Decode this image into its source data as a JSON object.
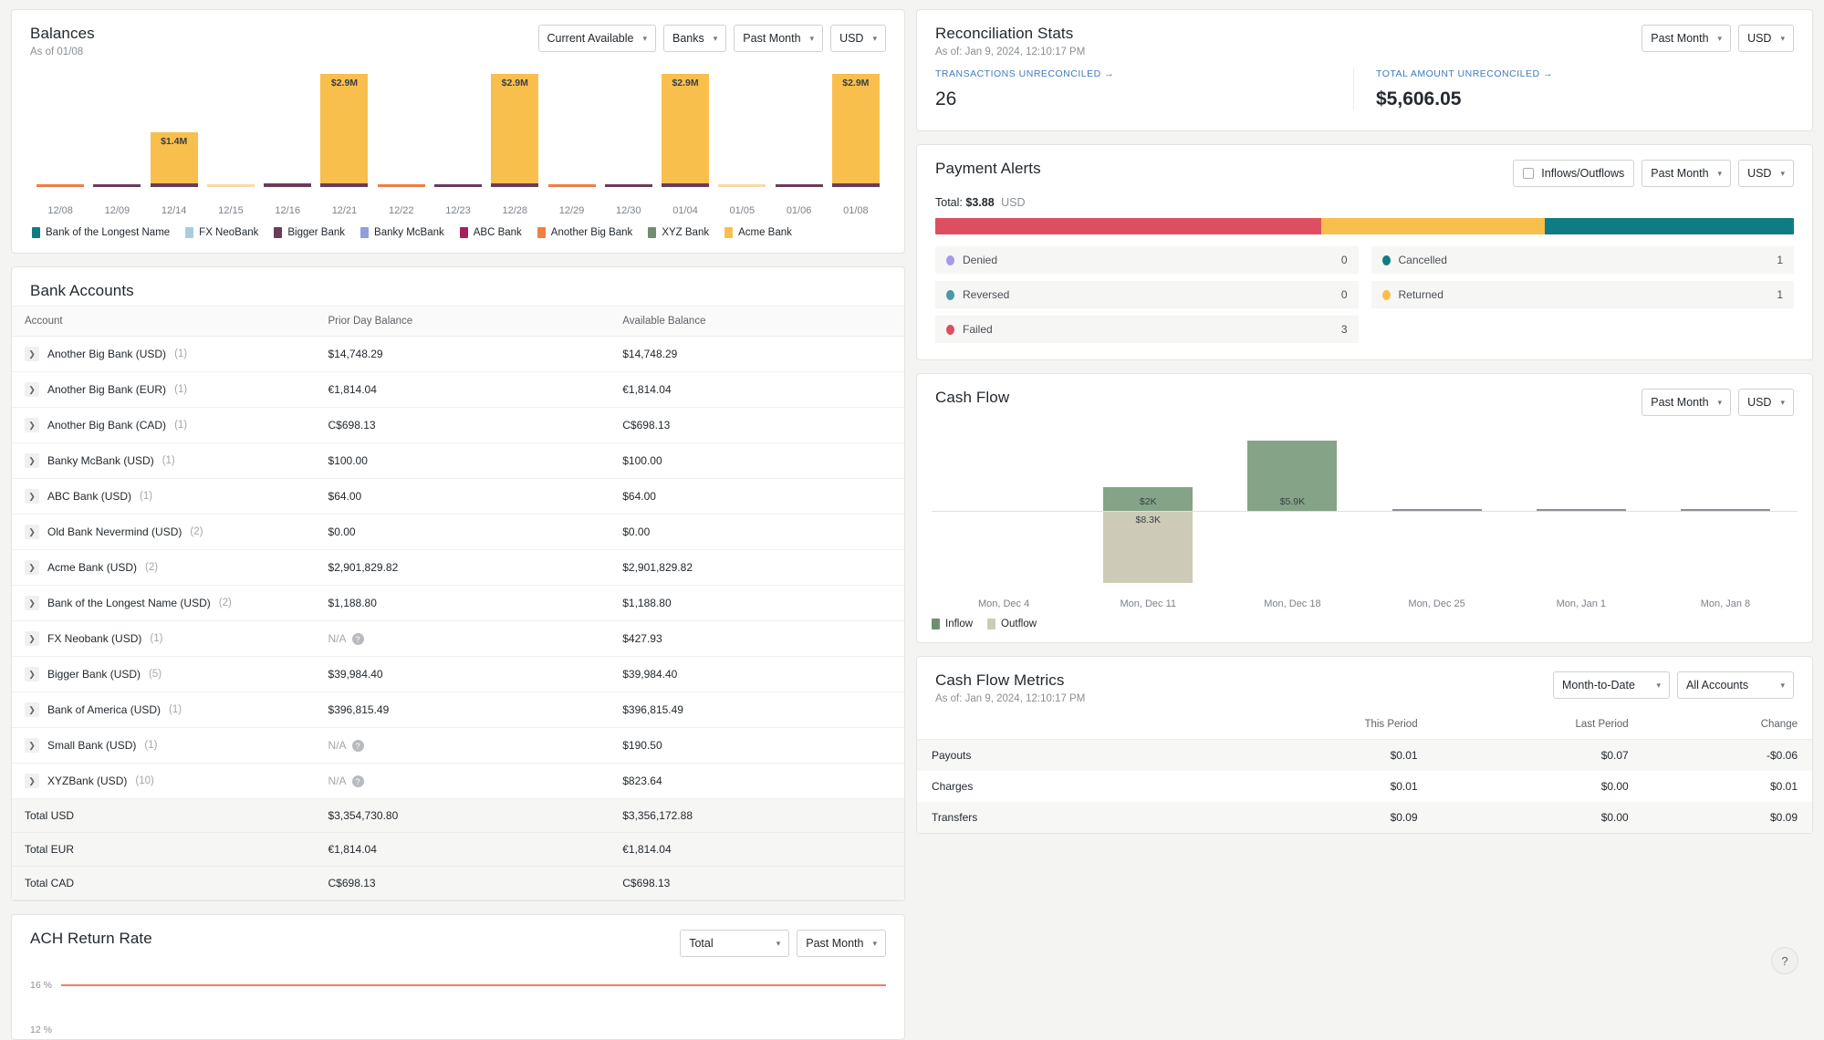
{
  "balances": {
    "title": "Balances",
    "subtitle": "As of 01/08",
    "controls": [
      {
        "name": "balance-type-select",
        "label": "Current Available"
      },
      {
        "name": "grouping-select",
        "label": "Banks"
      },
      {
        "name": "period-select",
        "label": "Past Month"
      },
      {
        "name": "currency-select",
        "label": "USD"
      }
    ],
    "chart_data": {
      "type": "bar",
      "title": "Balances",
      "xlabel": "",
      "ylabel": "",
      "categories": [
        "12/08",
        "12/09",
        "12/14",
        "12/15",
        "12/16",
        "12/21",
        "12/22",
        "12/23",
        "12/28",
        "12/29",
        "12/30",
        "01/04",
        "01/05",
        "01/06",
        "01/08"
      ],
      "values": [
        0.02,
        0.06,
        1.4,
        0.015,
        0.09,
        2.9,
        0.02,
        0.07,
        2.9,
        0.02,
        0.05,
        2.9,
        0.015,
        0.07,
        2.9
      ],
      "labels": [
        "",
        "",
        "$1.4M",
        "",
        "",
        "$2.9M",
        "",
        "",
        "$2.9M",
        "",
        "",
        "$2.9M",
        "",
        "",
        "$2.9M"
      ],
      "unit": "M USD",
      "legend_position": "bottom",
      "series": [
        {
          "name": "Acme Bank",
          "color": "#f9bf4d"
        },
        {
          "name": "Bigger Bank",
          "color": "#6b3b5a"
        },
        {
          "name": "Another Big Bank",
          "color": "#ef7e44"
        },
        {
          "name": "ABC Bank",
          "color": "#a81d5d"
        }
      ]
    },
    "legend": [
      {
        "label": "Bank of the Longest Name",
        "color": "#0f7c84"
      },
      {
        "label": "FX NeoBank",
        "color": "#a8cde0"
      },
      {
        "label": "Bigger Bank",
        "color": "#6b3b5a"
      },
      {
        "label": "Banky McBank",
        "color": "#8f9fe0"
      },
      {
        "label": "ABC Bank",
        "color": "#a81d5d"
      },
      {
        "label": "Another Big Bank",
        "color": "#ef7e44"
      },
      {
        "label": "XYZ Bank",
        "color": "#6f8f6e"
      },
      {
        "label": "Acme Bank",
        "color": "#f9bf4d"
      }
    ]
  },
  "bank_accounts": {
    "title": "Bank Accounts",
    "columns": [
      "Account",
      "Prior Day Balance",
      "Available Balance"
    ],
    "rows": [
      {
        "account": "Another Big Bank (USD)",
        "count": "(1)",
        "prior": "$14,748.29",
        "available": "$14,748.29",
        "prior_na": false
      },
      {
        "account": "Another Big Bank (EUR)",
        "count": "(1)",
        "prior": "€1,814.04",
        "available": "€1,814.04",
        "prior_na": false
      },
      {
        "account": "Another Big Bank (CAD)",
        "count": "(1)",
        "prior": "C$698.13",
        "available": "C$698.13",
        "prior_na": false
      },
      {
        "account": "Banky McBank (USD)",
        "count": "(1)",
        "prior": "$100.00",
        "available": "$100.00",
        "prior_na": false
      },
      {
        "account": "ABC Bank (USD)",
        "count": "(1)",
        "prior": "$64.00",
        "available": "$64.00",
        "prior_na": false
      },
      {
        "account": "Old Bank Nevermind (USD)",
        "count": "(2)",
        "prior": "$0.00",
        "available": "$0.00",
        "prior_na": false
      },
      {
        "account": "Acme Bank (USD)",
        "count": "(2)",
        "prior": "$2,901,829.82",
        "available": "$2,901,829.82",
        "prior_na": false
      },
      {
        "account": "Bank of the Longest Name (USD)",
        "count": "(2)",
        "prior": "$1,188.80",
        "available": "$1,188.80",
        "prior_na": false
      },
      {
        "account": "FX Neobank (USD)",
        "count": "(1)",
        "prior": "N/A",
        "available": "$427.93",
        "prior_na": true
      },
      {
        "account": "Bigger Bank (USD)",
        "count": "(5)",
        "prior": "$39,984.40",
        "available": "$39,984.40",
        "prior_na": false
      },
      {
        "account": "Bank of America (USD)",
        "count": "(1)",
        "prior": "$396,815.49",
        "available": "$396,815.49",
        "prior_na": false
      },
      {
        "account": "Small Bank (USD)",
        "count": "(1)",
        "prior": "N/A",
        "available": "$190.50",
        "prior_na": true
      },
      {
        "account": "XYZBank (USD)",
        "count": "(10)",
        "prior": "N/A",
        "available": "$823.64",
        "prior_na": true
      }
    ],
    "totals": [
      {
        "label": "Total USD",
        "prior": "$3,354,730.80",
        "available": "$3,356,172.88"
      },
      {
        "label": "Total EUR",
        "prior": "€1,814.04",
        "available": "€1,814.04"
      },
      {
        "label": "Total CAD",
        "prior": "C$698.13",
        "available": "C$698.13"
      }
    ]
  },
  "ach": {
    "title": "ACH Return Rate",
    "controls": [
      {
        "name": "ach-type-select",
        "label": "Total"
      },
      {
        "name": "ach-period-select",
        "label": "Past Month"
      }
    ],
    "chart_data": {
      "type": "line",
      "title": "ACH Return Rate",
      "ylabel": "%",
      "yticks": [
        "16 %",
        "12 %"
      ],
      "values": [
        16,
        16
      ],
      "line_color": "#ef7e63"
    }
  },
  "reconciliation": {
    "title": "Reconciliation Stats",
    "subtitle": "As of: Jan 9, 2024, 12:10:17 PM",
    "controls": [
      {
        "name": "recon-period-select",
        "label": "Past Month"
      },
      {
        "name": "recon-currency-select",
        "label": "USD"
      }
    ],
    "stats": [
      {
        "label": "TRANSACTIONS UNRECONCILED →",
        "value": "26"
      },
      {
        "label": "TOTAL AMOUNT UNRECONCILED →",
        "value": "$5,606.05"
      }
    ]
  },
  "payment_alerts": {
    "title": "Payment Alerts",
    "checkbox_label": "Inflows/Outflows",
    "controls": [
      {
        "name": "alerts-period-select",
        "label": "Past Month"
      },
      {
        "name": "alerts-currency-select",
        "label": "USD"
      }
    ],
    "total_prefix": "Total:",
    "total_amount": "$3.88",
    "total_currency": "USD",
    "chart_data": {
      "type": "bar",
      "title": "Payment Alerts distribution",
      "categories": [
        "Failed",
        "Returned",
        "Cancelled"
      ],
      "values": [
        45,
        26,
        29
      ],
      "colors": [
        "#dd4e60",
        "#f9bf4d",
        "#0f7c84"
      ]
    },
    "statuses": [
      {
        "label": "Denied",
        "count": "0",
        "color": "#a99ae8"
      },
      {
        "label": "Cancelled",
        "count": "1",
        "color": "#0f7c84"
      },
      {
        "label": "Reversed",
        "count": "0",
        "color": "#4a9aa4"
      },
      {
        "label": "Returned",
        "count": "1",
        "color": "#f9bf4d"
      },
      {
        "label": "Failed",
        "count": "3",
        "color": "#dd4e60"
      }
    ]
  },
  "cash_flow": {
    "title": "Cash Flow",
    "controls": [
      {
        "name": "cashflow-period-select",
        "label": "Past Month"
      },
      {
        "name": "cashflow-currency-select",
        "label": "USD"
      }
    ],
    "chart_data": {
      "type": "bar",
      "title": "Cash Flow",
      "xlabel": "",
      "ylabel": "",
      "categories": [
        "Mon, Dec 4",
        "Mon, Dec 11",
        "Mon, Dec 18",
        "Mon, Dec 25",
        "Mon, Jan 1",
        "Mon, Jan 8"
      ],
      "series": [
        {
          "name": "Inflow",
          "color": "#84a387",
          "values": [
            0,
            2000,
            5900,
            0,
            0,
            0
          ],
          "labels": [
            "",
            "$2K",
            "$5.9K",
            "",
            "",
            ""
          ]
        },
        {
          "name": "Outflow",
          "color": "#cdcab8",
          "values": [
            0,
            8300,
            0,
            0,
            0,
            0
          ],
          "labels": [
            "",
            "$8.3K",
            "",
            "",
            "",
            ""
          ]
        }
      ]
    },
    "legend": [
      {
        "label": "Inflow",
        "color": "#6f8f6e"
      },
      {
        "label": "Outflow",
        "color": "#cdcab8"
      }
    ]
  },
  "cash_flow_metrics": {
    "title": "Cash Flow Metrics",
    "subtitle": "As of: Jan 9, 2024, 12:10:17 PM",
    "controls": [
      {
        "name": "metrics-range-select",
        "label": "Month-to-Date"
      },
      {
        "name": "metrics-accounts-select",
        "label": "All Accounts"
      }
    ],
    "columns": [
      "",
      "This Period",
      "Last Period",
      "Change"
    ],
    "rows": [
      {
        "label": "Payouts",
        "this_period": "$0.01",
        "last_period": "$0.07",
        "change": "-$0.06"
      },
      {
        "label": "Charges",
        "this_period": "$0.01",
        "last_period": "$0.00",
        "change": "$0.01"
      },
      {
        "label": "Transfers",
        "this_period": "$0.09",
        "last_period": "$0.00",
        "change": "$0.09"
      }
    ]
  },
  "help": {
    "icon_label": "?"
  }
}
